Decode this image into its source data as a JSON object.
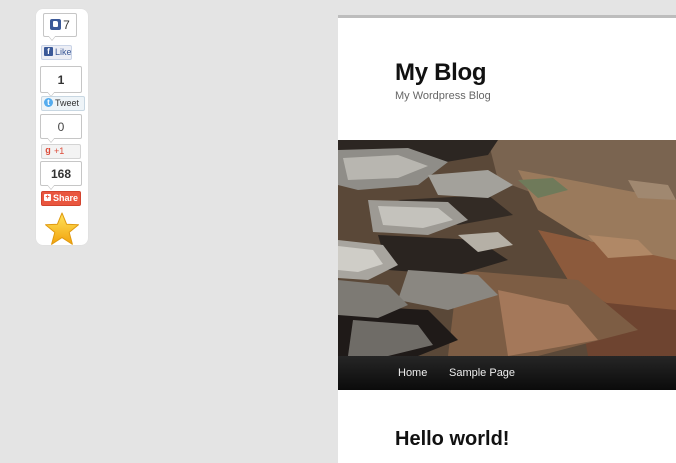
{
  "sharebar": {
    "facebook": {
      "count": "7",
      "label": "Like"
    },
    "twitter": {
      "count": "1",
      "label": "Tweet"
    },
    "googleplus": {
      "count": "0",
      "label": "+1"
    },
    "share": {
      "count": "168",
      "label": "Share"
    }
  },
  "site": {
    "title": "My Blog",
    "description": "My Wordpress Blog"
  },
  "nav": {
    "items": [
      {
        "label": "Home"
      },
      {
        "label": "Sample Page"
      }
    ]
  },
  "post": {
    "title": "Hello world!"
  },
  "colors": {
    "facebook": "#3b5998",
    "twitter": "#55acee",
    "googleplus": "#dd4b39",
    "share": "#e9563f",
    "nav_bg": "#111111"
  }
}
